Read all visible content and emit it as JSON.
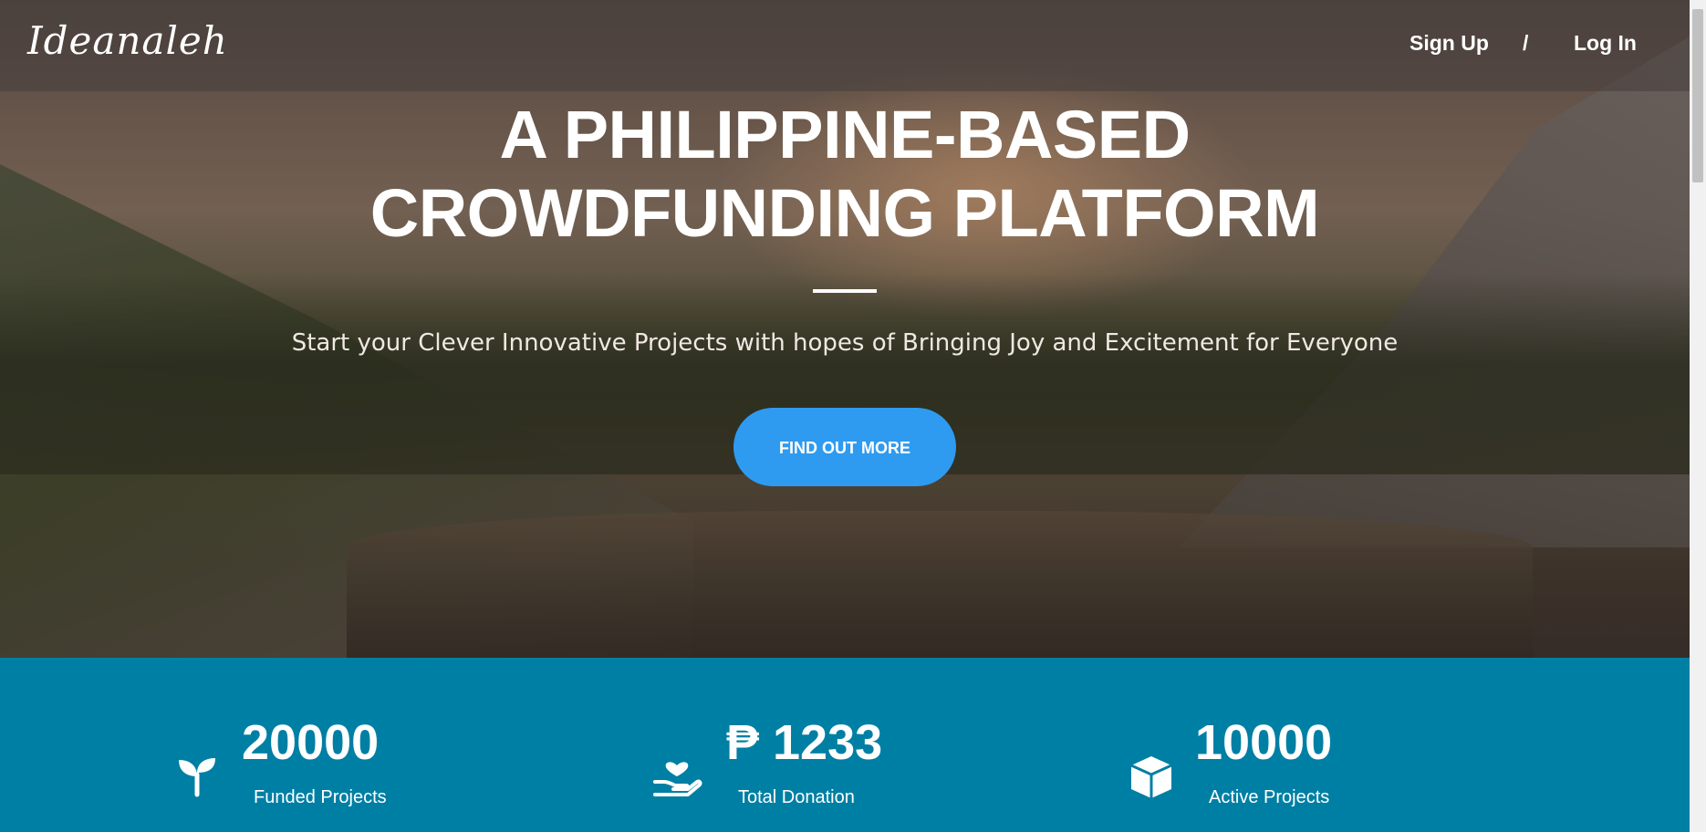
{
  "navbar": {
    "brand": "Ideanaleh",
    "signup_label": "Sign Up",
    "separator": "/",
    "login_label": "Log In"
  },
  "hero": {
    "headline": "A PHILIPPINE-BASED CROWDFUNDING PLATFORM",
    "subtitle": "Start your Clever Innovative Projects with hopes of Bringing Joy and Excitement for Everyone",
    "cta_label": "FIND OUT MORE"
  },
  "stats": [
    {
      "icon": "sprout-icon",
      "value": "20000",
      "label": "Funded Projects"
    },
    {
      "icon": "donation-hand-icon",
      "value": "₱ 1233",
      "label": "Total Donation"
    },
    {
      "icon": "box-icon",
      "value": "10000",
      "label": "Active Projects"
    }
  ],
  "colors": {
    "cta": "#2e9bf0",
    "stats_band": "#007fa4",
    "text": "#ffffff"
  }
}
